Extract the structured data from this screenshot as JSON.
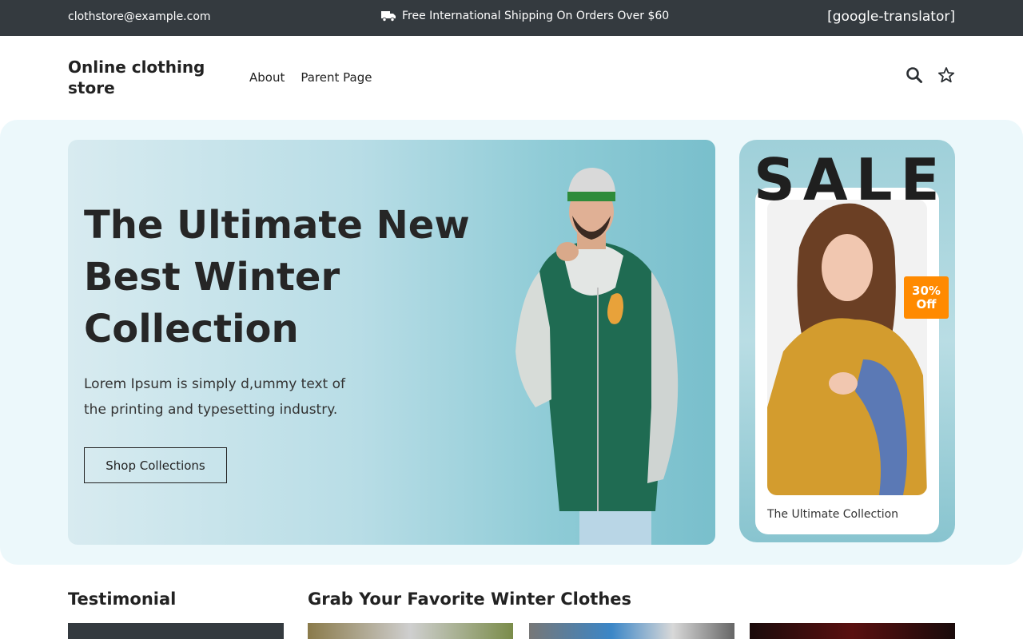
{
  "topbar": {
    "email": "clothstore@example.com",
    "shipping_text": "Free International Shipping On Orders Over $60",
    "translator": "[google-translator]"
  },
  "header": {
    "brand": "Online clothing store",
    "nav": [
      "About",
      "Parent Page"
    ],
    "icons": [
      "search-icon",
      "star-icon"
    ]
  },
  "hero": {
    "title": "The Ultimate New Best Winter Collection",
    "description": "Lorem Ipsum is simply d,ummy text of the printing and typesetting industry.",
    "cta": "Shop Collections"
  },
  "sale": {
    "word": "SALE",
    "badge_line1": "30%",
    "badge_line2": "Off",
    "caption": "The Ultimate Collection"
  },
  "sections": {
    "testimonial": "Testimonial",
    "favorites": "Grab Your Favorite Winter Clothes"
  },
  "colors": {
    "topbar_bg": "#343a3f",
    "accent_badge": "#ff8a00",
    "hero_bg_light": "#ecf8fb"
  }
}
